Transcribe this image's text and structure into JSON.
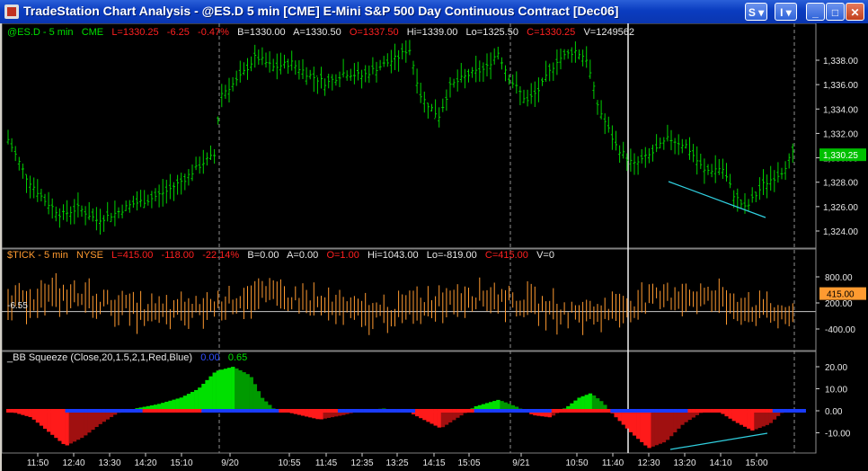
{
  "window": {
    "title": "TradeStation Chart Analysis - @ES.D  5 min  [CME] E-Mini S&P 500 Day Continuous Contract [Dec06]",
    "btn_s": "S ▾",
    "btn_i": "I ▾",
    "btn_min": "_",
    "btn_max": "□",
    "btn_close": "✕"
  },
  "price_header": {
    "symbol": "@ES.D - 5 min",
    "exchange": "CME",
    "last": "L=1330.25",
    "net": "-6.25",
    "pct": "-0.47%",
    "bid": "B=1330.00",
    "ask": "A=1330.50",
    "open": "O=1337.50",
    "high": "Hi=1339.00",
    "low": "Lo=1325.50",
    "close": "C=1330.25",
    "volume": "V=1249562"
  },
  "tick_header": {
    "symbol": "$TICK - 5 min",
    "exchange": "NYSE",
    "last": "L=415.00",
    "net": "-118.00",
    "pct": "-22.14%",
    "bid": "B=0.00",
    "ask": "A=0.00",
    "open": "O=1.00",
    "high": "Hi=1043.00",
    "low": "Lo=-819.00",
    "close": "C=415.00",
    "volume": "V=0"
  },
  "bb_header": {
    "name": "_BB Squeeze  (Close,20,1.5,2,1,Red,Blue)",
    "val1": "0.00",
    "val2": "0.65"
  },
  "price_axis": [
    "1,338.00",
    "1,336.00",
    "1,334.00",
    "1,332.00",
    "1,330.00",
    "1,328.00",
    "1,326.00",
    "1,324.00"
  ],
  "price_last_label": "1,330.25",
  "tick_axis": [
    "800.00",
    "200.00",
    "-400.00"
  ],
  "tick_last_label": "415.00",
  "tick_left_label": "-6.55",
  "bb_axis": [
    "20.00",
    "10.00",
    "0.00",
    "-10.00"
  ],
  "time_axis": [
    "11:50",
    "12:40",
    "13:30",
    "14:20",
    "15:10",
    "9/20",
    "10:55",
    "11:45",
    "12:35",
    "13:25",
    "14:15",
    "15:05",
    "9/21",
    "10:50",
    "11:40",
    "12:30",
    "13:20",
    "14:10",
    "15:00"
  ],
  "colors": {
    "price_bars": "#00d000",
    "tick_bars": "#ff9a30",
    "hist_positive": "#00e000",
    "hist_negative": "#ff1a1a",
    "squeeze_on": "#ff1a1a",
    "squeeze_off": "#1a3cff",
    "trendline": "#30d0e0",
    "last_price_box": "#00c000",
    "last_tick_box": "#ff9a30"
  }
}
